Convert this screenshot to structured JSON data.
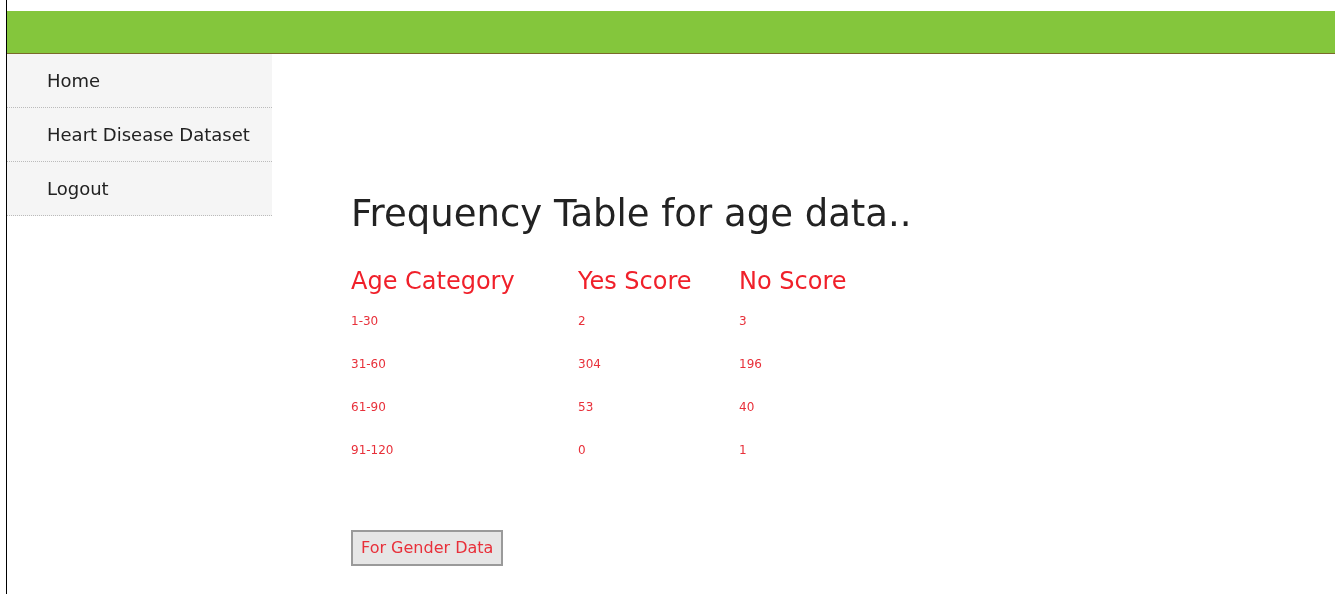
{
  "nav": {
    "items": [
      {
        "label": "Home"
      },
      {
        "label": "Heart Disease Dataset"
      },
      {
        "label": "Logout"
      }
    ]
  },
  "heading": "Frequency Table for age data..",
  "table": {
    "columns": [
      "Age Category",
      "Yes Score",
      "No Score"
    ],
    "rows": [
      [
        "1-30",
        "2",
        "3"
      ],
      [
        "31-60",
        "304",
        "196"
      ],
      [
        "61-90",
        "53",
        "40"
      ],
      [
        "91-120",
        "0",
        "1"
      ]
    ]
  },
  "button": "For Gender Data"
}
